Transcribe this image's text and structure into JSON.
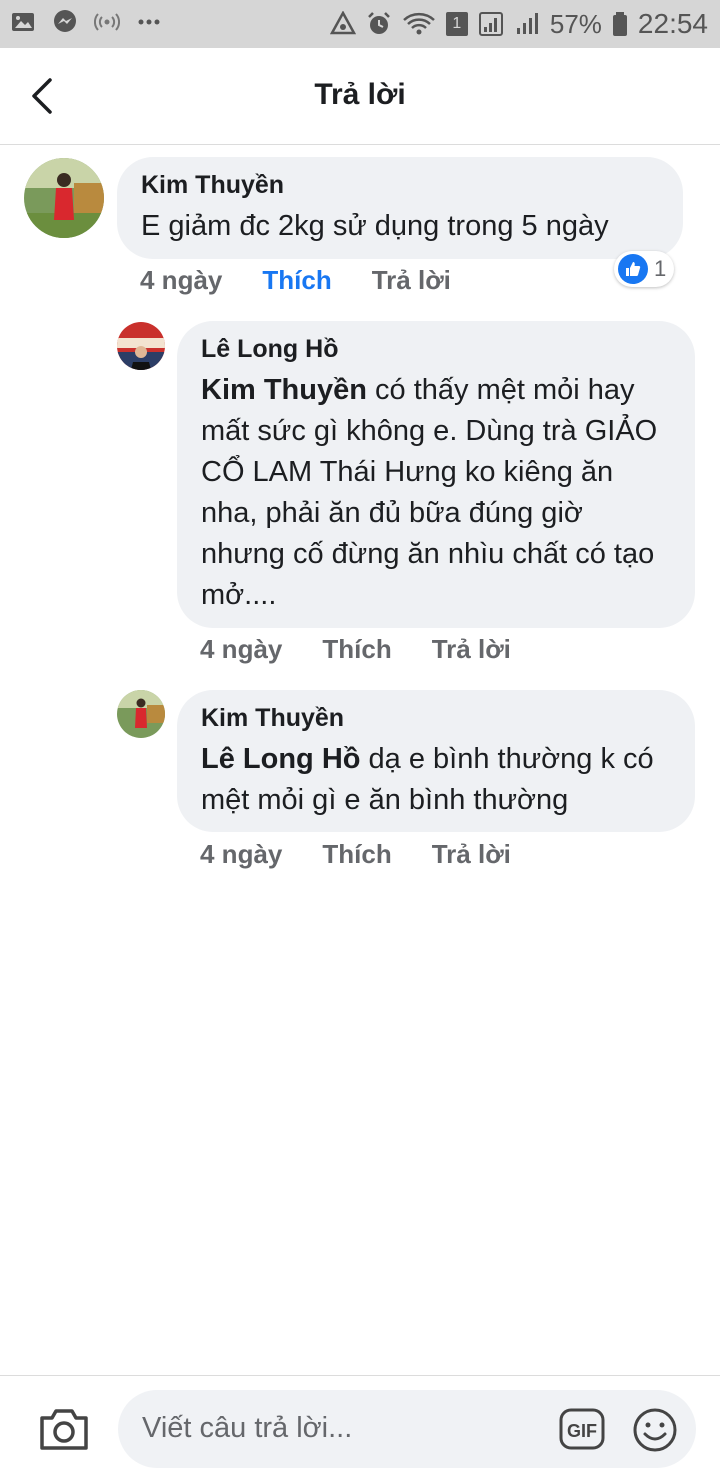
{
  "status_bar": {
    "battery_percent": "57%",
    "time": "22:54",
    "sim_badge": "1",
    "icons": [
      "gallery-icon",
      "messenger-icon",
      "hotspot-icon",
      "more-dots-icon",
      "data-saver-icon",
      "alarm-icon",
      "wifi-icon",
      "signal-icon",
      "battery-icon"
    ]
  },
  "header": {
    "title": "Trả lời",
    "back_icon": "chevron-left-icon"
  },
  "comments": [
    {
      "author": "Kim Thuyền",
      "mention": "",
      "text": "E giảm đc 2kg sử dụng trong 5 ngày",
      "time": "4 ngày",
      "like_label": "Thích",
      "reply_label": "Trả lời",
      "liked": true,
      "reaction_count": "1"
    },
    {
      "author": "Lê Long Hồ",
      "mention": "Kim Thuyền",
      "text": " có thấy mệt mỏi hay mất sức gì không e. Dùng trà GIẢO CỔ LAM Thái Hưng ko kiêng ăn nha, phải ăn đủ bữa đúng giờ nhưng cố đừng ăn nhìu chất có tạo mở....",
      "time": "4 ngày",
      "like_label": "Thích",
      "reply_label": "Trả lời",
      "liked": false
    },
    {
      "author": "Kim Thuyền",
      "mention": "Lê Long Hồ",
      "text": " dạ e bình thường k có mệt mỏi gì e ăn bình thường",
      "time": "4 ngày",
      "like_label": "Thích",
      "reply_label": "Trả lời",
      "liked": false
    }
  ],
  "composer": {
    "placeholder": "Viết câu trả lời...",
    "camera_icon": "camera-icon",
    "gif_label": "GIF",
    "emoji_icon": "smiley-icon"
  },
  "colors": {
    "accent": "#1877f2",
    "bubble": "#eff1f4",
    "muted_text": "#65676b",
    "status_bar": "#d6d6d6"
  }
}
